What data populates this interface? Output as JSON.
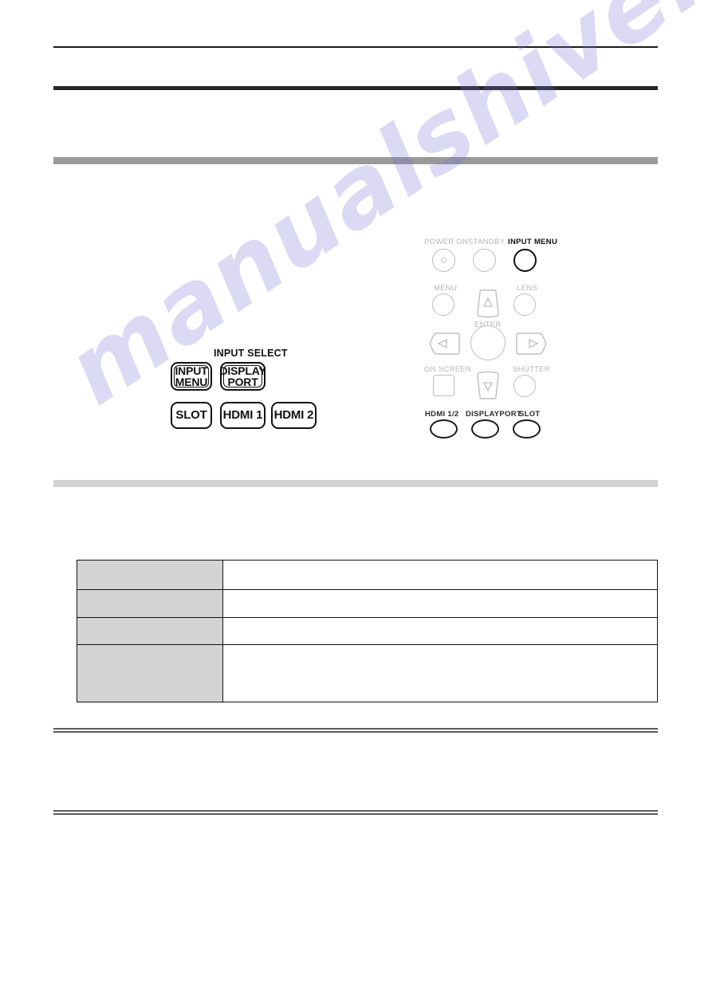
{
  "document": {
    "page_background": "#ffffff",
    "watermark_text": "manualshive.com",
    "watermark_color": "#786ed7"
  },
  "header": {
    "top_rule_color": "#1a1a1a",
    "section_bar_color": "#262626",
    "band_dark_color": "#999999",
    "band_light_color": "#d2d2d2"
  },
  "remote_figure": {
    "group_label": "INPUT SELECT",
    "buttons": [
      {
        "name": "input-menu",
        "line1": "INPUT",
        "line2": "MENU",
        "style": "double"
      },
      {
        "name": "displayport",
        "line1": "DISPLAY",
        "line2": "PORT",
        "style": "double"
      },
      {
        "name": "slot",
        "line1": "SLOT",
        "line2": "",
        "style": "single"
      },
      {
        "name": "hdmi1",
        "line1": "HDMI 1",
        "line2": "",
        "style": "single"
      },
      {
        "name": "hdmi2",
        "line1": "HDMI 2",
        "line2": "",
        "style": "single"
      }
    ]
  },
  "control_panel_figure": {
    "labels": {
      "power_on": "POWER ON",
      "standby": "STANDBY",
      "input_menu": "INPUT MENU",
      "menu": "MENU",
      "lens": "LENS",
      "enter": "ENTER",
      "on_screen": "ON SCREEN",
      "shutter": "SHUTTER",
      "hdmi_1_2": "HDMI 1/2",
      "displayport": "DISPLAYPORT",
      "slot": "SLOT"
    },
    "arrow_glyphs": {
      "up": "△",
      "down": "▽",
      "left": "◁",
      "right": "▷"
    },
    "highlighted_button": "INPUT MENU",
    "dim_color": "#b8b8bf",
    "highlight_color": "#111111"
  },
  "spec_table": {
    "header_cell_color": "#d4d4d4",
    "border_color": "#111111",
    "rows": [
      {
        "key": "",
        "value": ""
      },
      {
        "key": "",
        "value": ""
      },
      {
        "key": "",
        "value": ""
      },
      {
        "key": "",
        "value": ""
      }
    ]
  },
  "footer": {
    "rule_color": "#5a5a5a"
  }
}
